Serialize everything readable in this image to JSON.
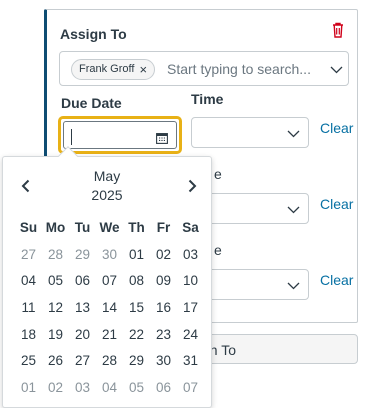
{
  "assign": {
    "label": "Assign To",
    "pill_name": "Frank Groff",
    "pill_remove": "×",
    "placeholder": "Start typing to search..."
  },
  "due_date": {
    "label": "Due Date",
    "value": ""
  },
  "time": {
    "label": "Time",
    "value": ""
  },
  "clear_labels": [
    "Clear",
    "Clear",
    "Clear"
  ],
  "peek_fragments": [
    "e",
    "e"
  ],
  "assign_button_fragment": "gn To",
  "calendar": {
    "month": "May",
    "year": "2025",
    "weekdays": [
      "Su",
      "Mo",
      "Tu",
      "We",
      "Th",
      "Fr",
      "Sa"
    ],
    "weeks": [
      [
        {
          "d": "27",
          "out": true
        },
        {
          "d": "28",
          "out": true
        },
        {
          "d": "29",
          "out": true
        },
        {
          "d": "30",
          "out": true
        },
        {
          "d": "01",
          "out": false
        },
        {
          "d": "02",
          "out": false
        },
        {
          "d": "03",
          "out": false
        }
      ],
      [
        {
          "d": "04",
          "out": false
        },
        {
          "d": "05",
          "out": false
        },
        {
          "d": "06",
          "out": false
        },
        {
          "d": "07",
          "out": false
        },
        {
          "d": "08",
          "out": false
        },
        {
          "d": "09",
          "out": false
        },
        {
          "d": "10",
          "out": false
        }
      ],
      [
        {
          "d": "11",
          "out": false
        },
        {
          "d": "12",
          "out": false
        },
        {
          "d": "13",
          "out": false
        },
        {
          "d": "14",
          "out": false
        },
        {
          "d": "15",
          "out": false
        },
        {
          "d": "16",
          "out": false
        },
        {
          "d": "17",
          "out": false
        }
      ],
      [
        {
          "d": "18",
          "out": false
        },
        {
          "d": "19",
          "out": false
        },
        {
          "d": "20",
          "out": false
        },
        {
          "d": "21",
          "out": false
        },
        {
          "d": "22",
          "out": false
        },
        {
          "d": "23",
          "out": false
        },
        {
          "d": "24",
          "out": false
        }
      ],
      [
        {
          "d": "25",
          "out": false
        },
        {
          "d": "26",
          "out": false
        },
        {
          "d": "27",
          "out": false
        },
        {
          "d": "28",
          "out": false
        },
        {
          "d": "29",
          "out": false
        },
        {
          "d": "30",
          "out": false
        },
        {
          "d": "31",
          "out": false
        }
      ],
      [
        {
          "d": "01",
          "out": true
        },
        {
          "d": "02",
          "out": true
        },
        {
          "d": "03",
          "out": true
        },
        {
          "d": "04",
          "out": true
        },
        {
          "d": "05",
          "out": true
        },
        {
          "d": "06",
          "out": true
        },
        {
          "d": "07",
          "out": true
        }
      ]
    ]
  },
  "icons": {
    "delete": "trash-icon",
    "chevron": "chevron-down-icon",
    "calendar": "calendar-icon",
    "prev": "chevron-left-icon",
    "next": "chevron-right-icon"
  },
  "colors": {
    "accent_border": "#0e4d73",
    "focus_ring": "#e8b116",
    "link": "#0770a3",
    "delete": "#d0021b"
  }
}
